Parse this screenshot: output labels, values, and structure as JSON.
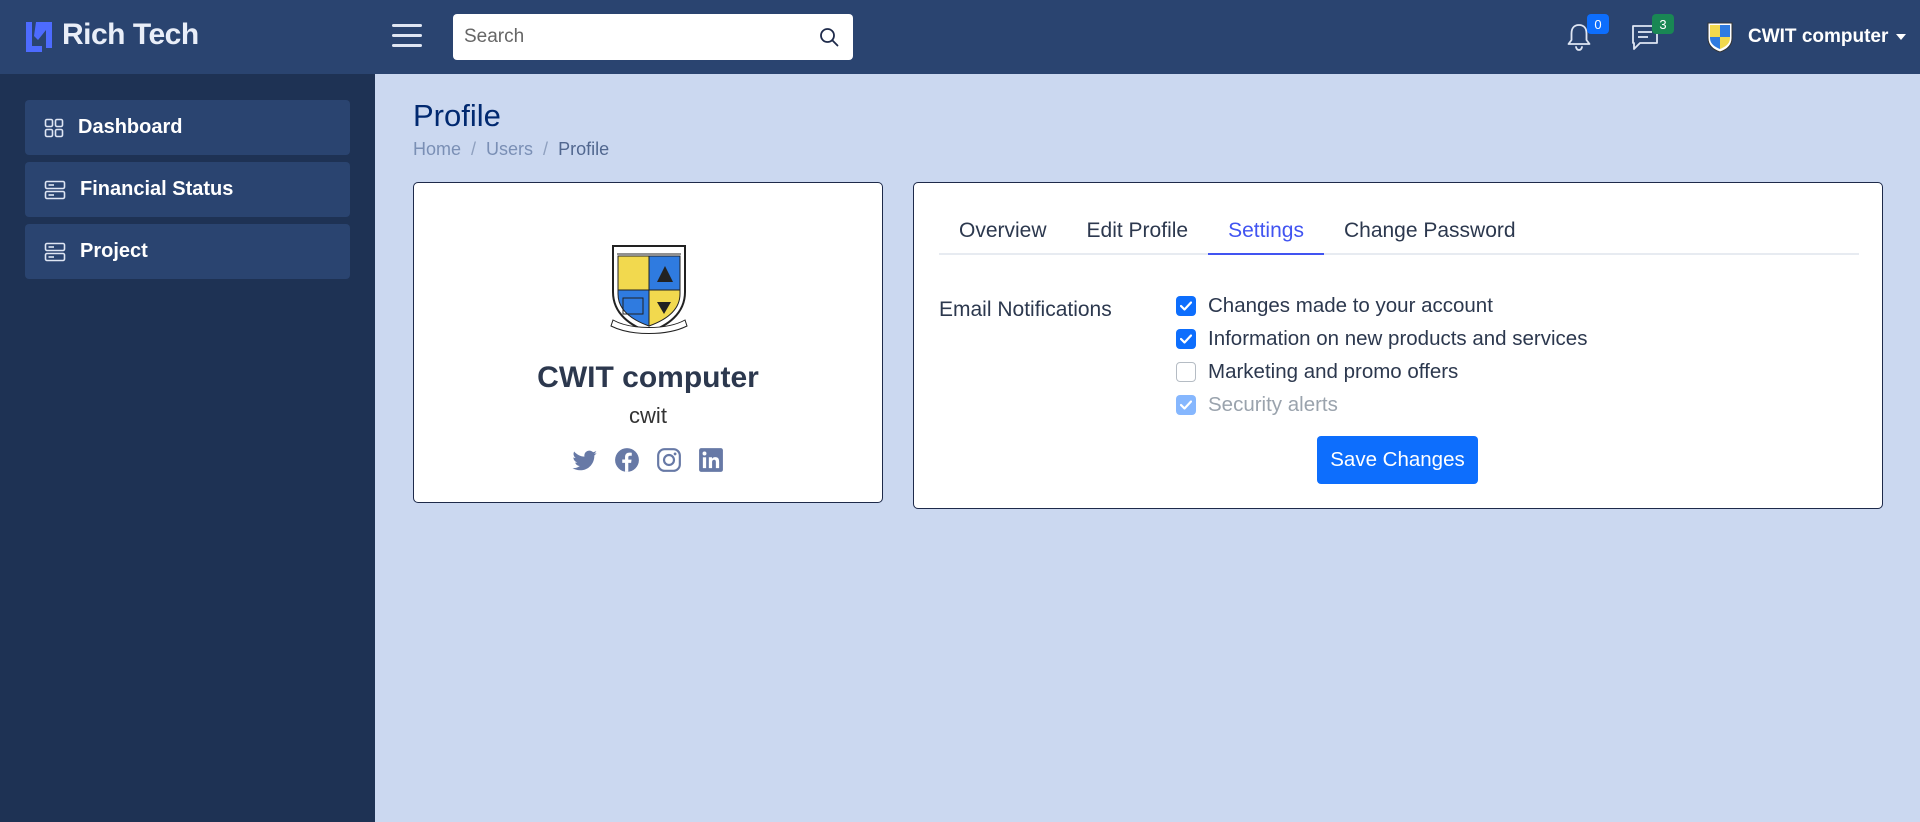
{
  "header": {
    "brand": "Rich Tech",
    "search_placeholder": "Search",
    "notifications_count": "0",
    "messages_count": "3",
    "user_name": "CWIT computer"
  },
  "sidebar": {
    "items": [
      {
        "label": "Dashboard",
        "icon": "grid-icon"
      },
      {
        "label": "Financial Status",
        "icon": "server-icon"
      },
      {
        "label": "Project",
        "icon": "server-icon"
      }
    ]
  },
  "page": {
    "title": "Profile",
    "breadcrumb": [
      "Home",
      "Users",
      "Profile"
    ]
  },
  "profile_card": {
    "full_name": "CWIT computer",
    "username": "cwit",
    "socials": [
      "twitter-icon",
      "facebook-icon",
      "instagram-icon",
      "linkedin-icon"
    ]
  },
  "tabs": [
    "Overview",
    "Edit Profile",
    "Settings",
    "Change Password"
  ],
  "active_tab": "Settings",
  "settings": {
    "section_label": "Email Notifications",
    "options": [
      {
        "label": "Changes made to your account",
        "checked": true,
        "disabled": false
      },
      {
        "label": "Information on new products and services",
        "checked": true,
        "disabled": false
      },
      {
        "label": "Marketing and promo offers",
        "checked": false,
        "disabled": false
      },
      {
        "label": "Security alerts",
        "checked": true,
        "disabled": true
      }
    ],
    "save_label": "Save Changes"
  },
  "colors": {
    "header_bg": "#2a4470",
    "sidebar_bg": "#1e3254",
    "content_bg": "#cbd8f0",
    "accent": "#4154f1",
    "primary_button": "#0d6efd"
  }
}
